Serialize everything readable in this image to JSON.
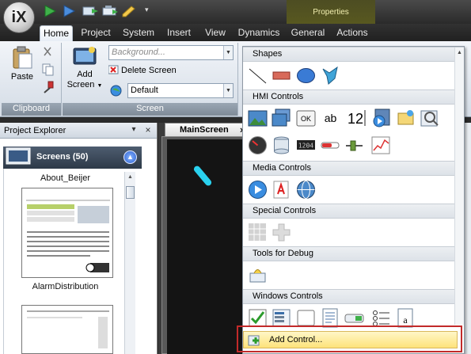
{
  "app": {
    "logo_text": "iX"
  },
  "quick_access": [
    {
      "name": "run-icon"
    },
    {
      "name": "run-simulator-icon"
    },
    {
      "name": "transfer-icon"
    },
    {
      "name": "transfer-project-icon"
    },
    {
      "name": "pencil-icon"
    },
    {
      "name": "customize-arrow-icon"
    }
  ],
  "context_tab": {
    "header": "Properties"
  },
  "tabs": [
    "Home",
    "Project",
    "System",
    "Insert",
    "View",
    "Dynamics",
    "General",
    "Actions"
  ],
  "ribbon": {
    "clipboard": {
      "paste_label": "Paste",
      "group_label": "Clipboard"
    },
    "screen": {
      "add_screen_label_1": "Add",
      "add_screen_label_2": "Screen",
      "background_placeholder": "Background...",
      "delete_screen_label": "Delete Screen",
      "theme_value": "Default",
      "group_label": "Screen"
    }
  },
  "project_explorer": {
    "title": "Project Explorer",
    "screens_label": "Screens (50)",
    "items": [
      "About_Beijer",
      "AlarmDistribution"
    ]
  },
  "document": {
    "tab_label": "MainScreen",
    "close": "×"
  },
  "dropdown": {
    "sections": [
      {
        "title": "Shapes",
        "icons": [
          "line-shape-icon",
          "rectangle-shape-icon",
          "ellipse-shape-icon",
          "polygon-shape-icon"
        ]
      },
      {
        "title": "HMI Controls",
        "icons": [
          "picture-icon",
          "multi-picture-icon",
          "button-icon",
          "text-icon",
          "analog-numeric-icon",
          "animated-label-icon",
          "folder-icon",
          "circular-meter-icon",
          "meter-icon",
          "digital-clock-icon",
          "slider-icon",
          "linear-meter-icon",
          "trend-viewer-icon",
          "roller-panel-icon",
          "database-icon"
        ],
        "icon_labels": {
          "button": "OK",
          "text": "ab",
          "numeric": "12",
          "clock": "1204"
        }
      },
      {
        "title": "Media Controls",
        "icons": [
          "media-player-icon",
          "pdf-viewer-icon",
          "web-browser-icon"
        ]
      },
      {
        "title": "Special Controls",
        "icons": [
          "grid-control-icon",
          "cross-control-icon"
        ]
      },
      {
        "title": "Tools for Debug",
        "icons": [
          "message-debug-icon"
        ]
      },
      {
        "title": "Windows Controls",
        "icons": [
          "checkbox-control-icon",
          "listbox-control-icon",
          "panel-control-icon",
          "textbox-control-icon",
          "button-control-icon",
          "listview-control-icon",
          "richtext-control-icon"
        ]
      }
    ],
    "add_control_label": "Add Control..."
  }
}
